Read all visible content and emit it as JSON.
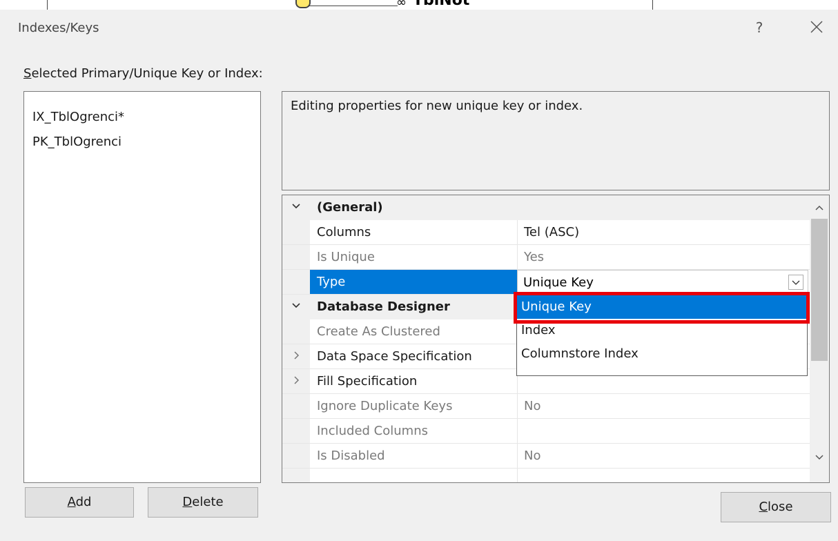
{
  "background": {
    "table_name": "TblNot",
    "relationship_symbol": "∞"
  },
  "dialog": {
    "title": "Indexes/Keys",
    "help_label": "?",
    "selected_label_first": "S",
    "selected_label_rest": "elected Primary/Unique Key or Index:"
  },
  "keys": [
    {
      "label": "IX_TblOgrenci*"
    },
    {
      "label": "PK_TblOgrenci"
    }
  ],
  "description": "Editing properties for new unique key or index.",
  "properties": {
    "general": {
      "label": "(General)",
      "columns_label": "Columns",
      "columns_value": "Tel (ASC)",
      "is_unique_label": "Is Unique",
      "is_unique_value": "Yes",
      "type_label": "Type",
      "type_value": "Unique Key"
    },
    "designer": {
      "label": "Database Designer",
      "create_clustered_label": "Create As Clustered",
      "data_space_label": "Data Space Specification",
      "fill_spec_label": "Fill Specification",
      "ignore_dup_label": "Ignore Duplicate Keys",
      "ignore_dup_value": "No",
      "included_cols_label": "Included Columns",
      "is_disabled_label": "Is Disabled",
      "is_disabled_value": "No"
    }
  },
  "type_dropdown": {
    "options": [
      {
        "label": "Unique Key",
        "selected": true
      },
      {
        "label": "Index"
      },
      {
        "label": "Columnstore Index"
      }
    ]
  },
  "buttons": {
    "add_first": "A",
    "add_rest": "dd",
    "delete_first": "D",
    "delete_rest": "elete",
    "close_first": "C",
    "close_rest": "lose"
  },
  "colors": {
    "selection": "#0078d7",
    "highlight_frame": "#e8000b"
  }
}
